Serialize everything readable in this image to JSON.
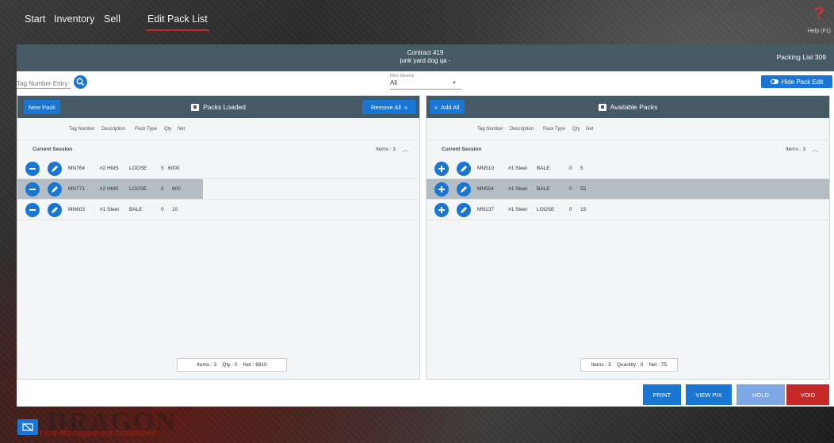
{
  "nav": {
    "items": [
      {
        "label": "Start"
      },
      {
        "label": "Inventory"
      },
      {
        "label": "Sell"
      },
      {
        "label": "Edit Pack List"
      }
    ],
    "help_label": "Help (F1)"
  },
  "header": {
    "contract": "Contract 419",
    "customer": "junk yard dog qa -",
    "packing_list": "Packing List 309"
  },
  "toolbar": {
    "tag_placeholder": "Tag Number Entry",
    "filter_label": "Filter Material",
    "filter_value": "All",
    "hide_pack_edit": "Hide Pack Edit"
  },
  "left_panel": {
    "new_pack": "New Pack",
    "title": "Packs Loaded",
    "remove_all": "Remove All",
    "columns": [
      "Tag Number",
      "Description",
      "Pack Type",
      "Qty",
      "Net"
    ],
    "session_label": "Current Session",
    "items_label": "Items : 3",
    "rows": [
      {
        "tag": "MN764",
        "desc": "#2 HMS",
        "type": "LOOSE",
        "qty": "5",
        "net": "6000",
        "selected": false
      },
      {
        "tag": "MN771",
        "desc": "#2 HMS",
        "type": "LOOSE",
        "qty": "0",
        "net": "800",
        "selected": true
      },
      {
        "tag": "MN603",
        "desc": "#1 Steel",
        "type": "BALE",
        "qty": "0",
        "net": "10",
        "selected": false
      }
    ],
    "summary": "Items : 3    Qty : 0    Net : 6810"
  },
  "right_panel": {
    "add_all": "Add All",
    "title": "Available Packs",
    "columns": [
      "Tag Number",
      "Description",
      "Pack Type",
      "Qty",
      "Net"
    ],
    "session_label": "Current Session",
    "items_label": "Items : 3",
    "rows": [
      {
        "tag": "MN510",
        "desc": "#1 Steel",
        "type": "BALE",
        "qty": "0",
        "net": "5",
        "selected": false
      },
      {
        "tag": "MN504",
        "desc": "#1 Steel",
        "type": "BALE",
        "qty": "0",
        "net": "55",
        "selected": true
      },
      {
        "tag": "MN137",
        "desc": "#1 Steel",
        "type": "LOOSE",
        "qty": "0",
        "net": "15",
        "selected": false
      }
    ],
    "summary": "Items : 3    Quantity : 0    Net : 75"
  },
  "footer": {
    "print": "PRINT",
    "view_pix": "VIEW PIX",
    "hold": "HOLD",
    "void": "VOID"
  },
  "branding": {
    "title": "DRAGON",
    "subtitle": "Yard Management Simplified"
  },
  "colors": {
    "accent": "#1976d2",
    "header": "#455a64",
    "hold": "#7ea7e6",
    "void": "#c62828",
    "selected_row": "#b5bec4"
  }
}
